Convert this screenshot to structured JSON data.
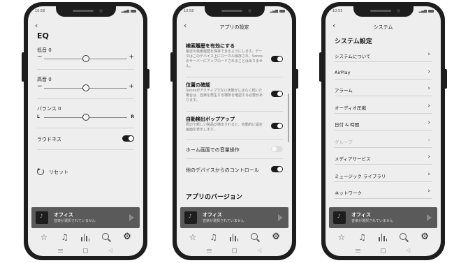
{
  "status_bar": {
    "p1_time": "10:58",
    "p2_time": "10:58",
    "p3_time": "10:55"
  },
  "eq_screen": {
    "title": "EQ",
    "bass": {
      "label": "低音 0",
      "min": "−",
      "max": "+",
      "value": 0.5
    },
    "treble": {
      "label": "高音 0",
      "min": "−",
      "max": "+",
      "value": 0.5
    },
    "balance": {
      "label": "バランス 0",
      "min": "L",
      "max": "R",
      "value": 0.5
    },
    "loudness": {
      "label": "ラウドネス",
      "on": true
    },
    "reset": "リセット"
  },
  "app_settings_screen": {
    "title": "アプリの設定",
    "search_history": {
      "title": "検索履歴を有効にする",
      "description": "最近の検索履歴を保存できるようにします。データはこのデバイス上にローカル保存され、Sonosのサーバーにアップロードされることはありません。",
      "on": true
    },
    "location": {
      "title": "位置の確認",
      "description": "Sonosがアクティブでない状態がしばらく続いた場合は、音楽を再生する場所を確認する必要があります。",
      "on": true
    },
    "auto_detect_popup": {
      "title": "自動検出ポップアップ",
      "description": "周辺で新しい製品が検出されると、自動的に設定画面を表示します。",
      "on": true
    },
    "home_screen_volume": {
      "label": "ホーム画面での音量操作",
      "on": false
    },
    "other_devices_control": {
      "label": "他のデバイスからのコントロール",
      "on": true
    },
    "app_version": "アプリのバージョン"
  },
  "system_screen": {
    "title": "システム",
    "heading": "システム設定",
    "items": [
      {
        "label": "システムについて",
        "disabled": false
      },
      {
        "label": "AirPlay",
        "disabled": false
      },
      {
        "label": "アラーム",
        "disabled": false
      },
      {
        "label": "オーディオ圧縮",
        "disabled": false
      },
      {
        "label": "日付 & 時間",
        "disabled": false
      },
      {
        "label": "グループ",
        "disabled": true
      },
      {
        "label": "メディアサービス",
        "disabled": false
      },
      {
        "label": "ミュージック ライブラリ",
        "disabled": false
      },
      {
        "label": "ネットワーク",
        "disabled": false
      }
    ]
  },
  "now_playing": {
    "room": "オフィス",
    "status": "音楽が選択されていません"
  },
  "tabs": [
    "favorites-icon",
    "music-icon",
    "rooms-icon",
    "search-icon",
    "settings-icon"
  ],
  "colors": {
    "screen_bg": "#eeeeee",
    "now_playing_bg": "#5a5a5a",
    "toggle_on": "#1a1a1a",
    "phone_body": "#1d1d1d"
  }
}
